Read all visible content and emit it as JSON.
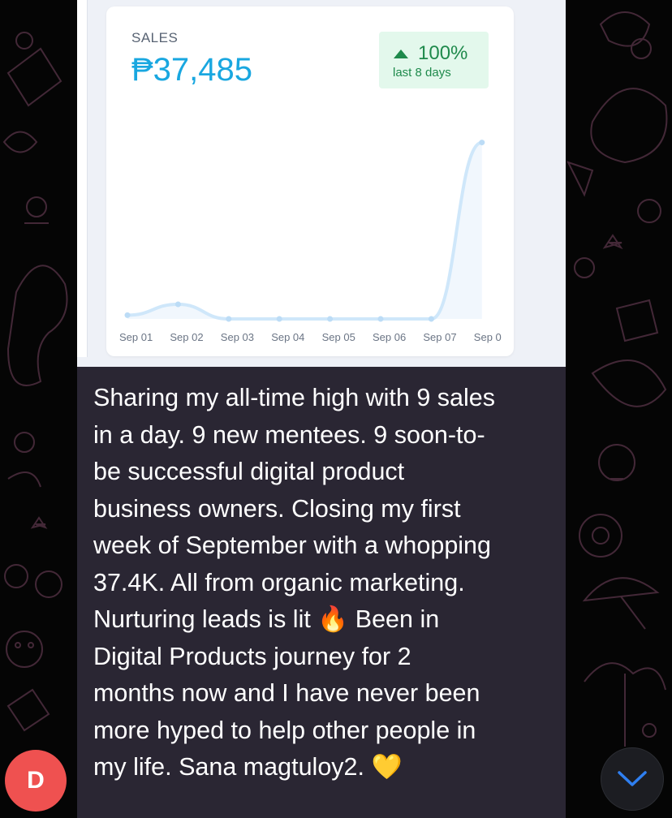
{
  "card": {
    "label": "SALES",
    "amount": "₱37,485",
    "badge": {
      "percent": "100%",
      "period": "last 8 days",
      "trend_icon": "triangle-up-icon",
      "color": "#1f8a4c"
    }
  },
  "chart_data": {
    "type": "area",
    "categories": [
      "Sep 01",
      "Sep 02",
      "Sep 03",
      "Sep 04",
      "Sep 05",
      "Sep 06",
      "Sep 07",
      "Sep 0"
    ],
    "series": [
      {
        "values": [
          0.8,
          3.1,
          0,
          0,
          0,
          0,
          0,
          37.485
        ]
      }
    ],
    "ylim": [
      0,
      45
    ],
    "grid": false,
    "color": "#cfe7fa"
  },
  "message": {
    "lines": [
      "Sharing my all-time high with 9 sales",
      "in a day. 9 new mentees. 9 soon-to-",
      "be successful digital product",
      "business owners. Closing my first",
      "week of September with a whopping",
      "37.4K. All from organic marketing.",
      "Nurturing leads is lit 🔥 Been in",
      "Digital Products journey for 2",
      "months now and I have never been",
      "more hyped to help other people in",
      "my life. Sana magtuloy2. 💛"
    ]
  },
  "avatar": {
    "letter": "D",
    "color": "#ef5150"
  },
  "scroll_button": {
    "icon": "chevron-down-icon",
    "color": "#2f7ff0"
  }
}
